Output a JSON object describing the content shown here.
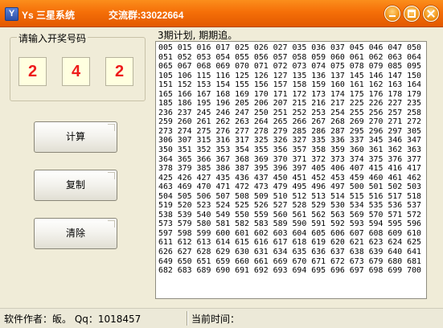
{
  "window": {
    "icon_text": "Y",
    "title": "Ys 三星系统",
    "group_info": "交流群:33022664"
  },
  "input_group": {
    "label": "请输入开奖号码",
    "numbers": [
      "2",
      "4",
      "2"
    ]
  },
  "buttons": {
    "calculate": "计算",
    "copy": "复制",
    "clear": "清除"
  },
  "result": {
    "header": "3期计划, 期期追。",
    "text": "005 015 016 017 025 026 027 035 036 037 045 046 047 050 051 052 053 054 055 056 057 058 059 060 061 062 063 064 065 067 068 069 070 071 072 073 074 075 078 079 085 095 105 106 115 116 125 126 127 135 136 137 145 146 147 150 151 152 153 154 155 156 157 158 159 160 161 162 163 164 165 166 167 168 169 170 171 172 173 174 175 176 178 179 185 186 195 196 205 206 207 215 216 217 225 226 227 235 236 237 245 246 247 250 251 252 253 254 255 256 257 258 259 260 261 262 263 264 265 266 267 268 269 270 271 272 273 274 275 276 277 278 279 285 286 287 295 296 297 305 306 307 315 316 317 325 326 327 335 336 337 345 346 347 350 351 352 353 354 355 356 357 358 359 360 361 362 363 364 365 366 367 368 369 370 371 372 373 374 375 376 377 378 379 385 386 387 395 396 397 405 406 407 415 416 417 425 426 427 435 436 437 450 451 452 453 459 460 461 462 463 469 470 471 472 473 479 495 496 497 500 501 502 503 504 505 506 507 508 509 510 512 513 514 515 516 517 518 519 520 523 524 525 526 527 528 529 530 534 535 536 537 538 539 540 549 550 559 560 561 562 563 569 570 571 572 573 579 580 581 582 583 589 590 591 592 593 594 595 596 597 598 599 600 601 602 603 604 605 606 607 608 609 610 611 612 613 614 615 616 617 618 619 620 621 623 624 625 626 627 628 629 630 631 634 635 636 637 638 639 640 641 649 650 651 659 660 661 669 670 671 672 673 679 680 681 682 683 689 690 691 692 693 694 695 696 697 698 699 700"
  },
  "status": {
    "author": "软件作者：皈。 Qq：1018457",
    "time_label": "当前时间："
  },
  "colors": {
    "titlebar": "#f56f08",
    "number_text": "#ee1b1b",
    "number_bg": "#ffffe0",
    "window_bg": "#f0ecd8"
  }
}
